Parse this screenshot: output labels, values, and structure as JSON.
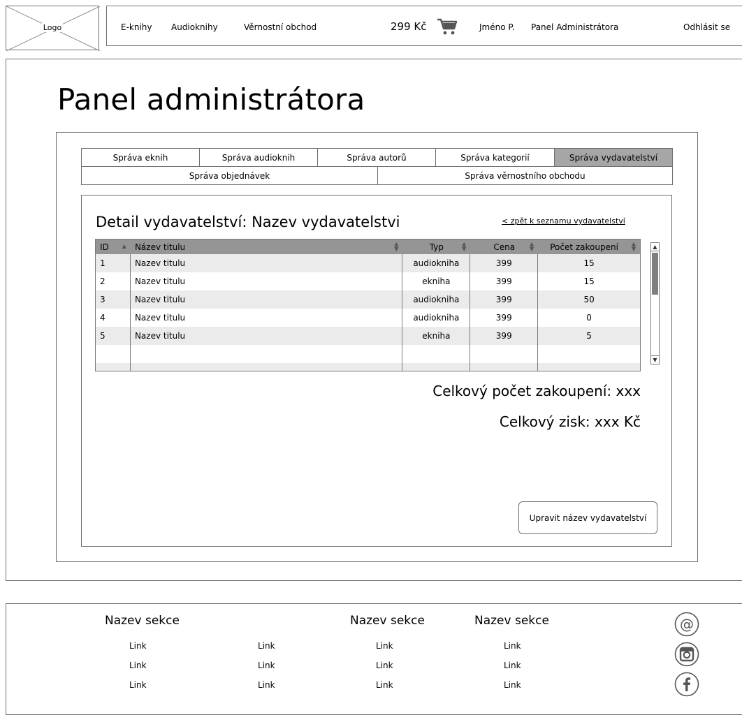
{
  "header": {
    "logo": "Logo",
    "nav": [
      "E-knihy",
      "Audioknihy",
      "Věrnostní obchod"
    ],
    "price": "299 Kč",
    "cart_icon": "cart-icon",
    "user": "Jméno P.",
    "admin_link": "Panel Administrátora",
    "logout": "Odhlásit se"
  },
  "page": {
    "title": "Panel administrátora"
  },
  "tabs": {
    "row1": [
      "Správa eknih",
      "Správa audioknih",
      "Správa autorů",
      "Správa kategorií",
      "Správa vydavatelství"
    ],
    "row2": [
      "Správa objednávek",
      "Správa věrnostního obchodu"
    ],
    "active": "Správa vydavatelství"
  },
  "detail": {
    "title": "Detail vydavatelství: Nazev vydavatelstvi",
    "back_link": "< zpět k seznamu vydavatelství"
  },
  "table": {
    "columns": [
      "ID",
      "Název titulu",
      "Typ",
      "Cena",
      "Počet zakoupení"
    ],
    "rows": [
      [
        "1",
        "Nazev titulu",
        "audiokniha",
        "399",
        "15"
      ],
      [
        "2",
        "Nazev titulu",
        "ekniha",
        "399",
        "15"
      ],
      [
        "3",
        "Nazev titulu",
        "audiokniha",
        "399",
        "50"
      ],
      [
        "4",
        "Nazev titulu",
        "audiokniha",
        "399",
        "0"
      ],
      [
        "5",
        "Nazev titulu",
        "ekniha",
        "399",
        "5"
      ]
    ]
  },
  "totals": {
    "purchases": "Celkový počet zakoupení: xxx",
    "profit": "Celkový zisk: xxx Kč"
  },
  "actions": {
    "rename": "Upravit název vydavatelství"
  },
  "footer": {
    "sections": [
      "Nazev sekce",
      "Nazev sekce",
      "Nazev sekce"
    ],
    "link": "Link",
    "social": [
      "at-icon",
      "instagram-icon",
      "facebook-icon"
    ]
  }
}
